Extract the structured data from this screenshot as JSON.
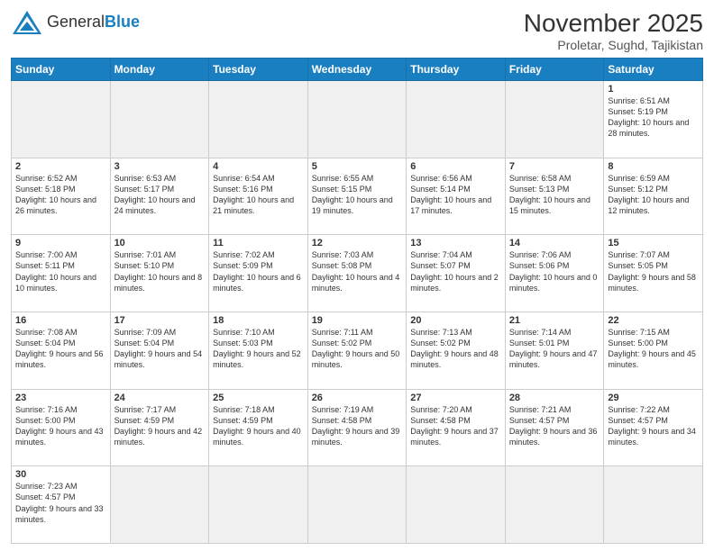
{
  "header": {
    "logo_general": "General",
    "logo_blue": "Blue",
    "title": "November 2025",
    "subtitle": "Proletar, Sughd, Tajikistan"
  },
  "weekdays": [
    "Sunday",
    "Monday",
    "Tuesday",
    "Wednesday",
    "Thursday",
    "Friday",
    "Saturday"
  ],
  "weeks": [
    [
      {
        "day": "",
        "info": ""
      },
      {
        "day": "",
        "info": ""
      },
      {
        "day": "",
        "info": ""
      },
      {
        "day": "",
        "info": ""
      },
      {
        "day": "",
        "info": ""
      },
      {
        "day": "",
        "info": ""
      },
      {
        "day": "1",
        "info": "Sunrise: 6:51 AM\nSunset: 5:19 PM\nDaylight: 10 hours\nand 28 minutes."
      }
    ],
    [
      {
        "day": "2",
        "info": "Sunrise: 6:52 AM\nSunset: 5:18 PM\nDaylight: 10 hours\nand 26 minutes."
      },
      {
        "day": "3",
        "info": "Sunrise: 6:53 AM\nSunset: 5:17 PM\nDaylight: 10 hours\nand 24 minutes."
      },
      {
        "day": "4",
        "info": "Sunrise: 6:54 AM\nSunset: 5:16 PM\nDaylight: 10 hours\nand 21 minutes."
      },
      {
        "day": "5",
        "info": "Sunrise: 6:55 AM\nSunset: 5:15 PM\nDaylight: 10 hours\nand 19 minutes."
      },
      {
        "day": "6",
        "info": "Sunrise: 6:56 AM\nSunset: 5:14 PM\nDaylight: 10 hours\nand 17 minutes."
      },
      {
        "day": "7",
        "info": "Sunrise: 6:58 AM\nSunset: 5:13 PM\nDaylight: 10 hours\nand 15 minutes."
      },
      {
        "day": "8",
        "info": "Sunrise: 6:59 AM\nSunset: 5:12 PM\nDaylight: 10 hours\nand 12 minutes."
      }
    ],
    [
      {
        "day": "9",
        "info": "Sunrise: 7:00 AM\nSunset: 5:11 PM\nDaylight: 10 hours\nand 10 minutes."
      },
      {
        "day": "10",
        "info": "Sunrise: 7:01 AM\nSunset: 5:10 PM\nDaylight: 10 hours\nand 8 minutes."
      },
      {
        "day": "11",
        "info": "Sunrise: 7:02 AM\nSunset: 5:09 PM\nDaylight: 10 hours\nand 6 minutes."
      },
      {
        "day": "12",
        "info": "Sunrise: 7:03 AM\nSunset: 5:08 PM\nDaylight: 10 hours\nand 4 minutes."
      },
      {
        "day": "13",
        "info": "Sunrise: 7:04 AM\nSunset: 5:07 PM\nDaylight: 10 hours\nand 2 minutes."
      },
      {
        "day": "14",
        "info": "Sunrise: 7:06 AM\nSunset: 5:06 PM\nDaylight: 10 hours\nand 0 minutes."
      },
      {
        "day": "15",
        "info": "Sunrise: 7:07 AM\nSunset: 5:05 PM\nDaylight: 9 hours\nand 58 minutes."
      }
    ],
    [
      {
        "day": "16",
        "info": "Sunrise: 7:08 AM\nSunset: 5:04 PM\nDaylight: 9 hours\nand 56 minutes."
      },
      {
        "day": "17",
        "info": "Sunrise: 7:09 AM\nSunset: 5:04 PM\nDaylight: 9 hours\nand 54 minutes."
      },
      {
        "day": "18",
        "info": "Sunrise: 7:10 AM\nSunset: 5:03 PM\nDaylight: 9 hours\nand 52 minutes."
      },
      {
        "day": "19",
        "info": "Sunrise: 7:11 AM\nSunset: 5:02 PM\nDaylight: 9 hours\nand 50 minutes."
      },
      {
        "day": "20",
        "info": "Sunrise: 7:13 AM\nSunset: 5:02 PM\nDaylight: 9 hours\nand 48 minutes."
      },
      {
        "day": "21",
        "info": "Sunrise: 7:14 AM\nSunset: 5:01 PM\nDaylight: 9 hours\nand 47 minutes."
      },
      {
        "day": "22",
        "info": "Sunrise: 7:15 AM\nSunset: 5:00 PM\nDaylight: 9 hours\nand 45 minutes."
      }
    ],
    [
      {
        "day": "23",
        "info": "Sunrise: 7:16 AM\nSunset: 5:00 PM\nDaylight: 9 hours\nand 43 minutes."
      },
      {
        "day": "24",
        "info": "Sunrise: 7:17 AM\nSunset: 4:59 PM\nDaylight: 9 hours\nand 42 minutes."
      },
      {
        "day": "25",
        "info": "Sunrise: 7:18 AM\nSunset: 4:59 PM\nDaylight: 9 hours\nand 40 minutes."
      },
      {
        "day": "26",
        "info": "Sunrise: 7:19 AM\nSunset: 4:58 PM\nDaylight: 9 hours\nand 39 minutes."
      },
      {
        "day": "27",
        "info": "Sunrise: 7:20 AM\nSunset: 4:58 PM\nDaylight: 9 hours\nand 37 minutes."
      },
      {
        "day": "28",
        "info": "Sunrise: 7:21 AM\nSunset: 4:57 PM\nDaylight: 9 hours\nand 36 minutes."
      },
      {
        "day": "29",
        "info": "Sunrise: 7:22 AM\nSunset: 4:57 PM\nDaylight: 9 hours\nand 34 minutes."
      }
    ],
    [
      {
        "day": "30",
        "info": "Sunrise: 7:23 AM\nSunset: 4:57 PM\nDaylight: 9 hours\nand 33 minutes."
      },
      {
        "day": "",
        "info": ""
      },
      {
        "day": "",
        "info": ""
      },
      {
        "day": "",
        "info": ""
      },
      {
        "day": "",
        "info": ""
      },
      {
        "day": "",
        "info": ""
      },
      {
        "day": "",
        "info": ""
      }
    ]
  ]
}
